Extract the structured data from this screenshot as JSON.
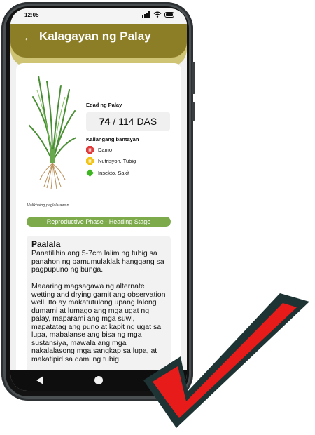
{
  "status_bar": {
    "time": "12:05"
  },
  "header": {
    "back_icon": "back-arrow-icon",
    "title": "Kalagayan ng Palay"
  },
  "plant": {
    "image_icon": "rice-plant-icon",
    "caption": "Malikhaing paglalarawan"
  },
  "age": {
    "label": "Edad ng Palay",
    "current": "74",
    "separator": "/",
    "total": "114 DAS"
  },
  "watch": {
    "label": "Kailangang bantayan",
    "items": [
      {
        "icon": "weed-warning-icon",
        "label": "Damo",
        "color": "#e03a3a"
      },
      {
        "icon": "nutrition-warning-icon",
        "label": "Nutrisyon, Tubig",
        "color": "#f2c416"
      },
      {
        "icon": "pest-warning-icon",
        "label": "Insekto, Sakit",
        "color": "#3cb521"
      }
    ]
  },
  "phase": {
    "label": "Reproductive Phase - Heading Stage",
    "color": "#7dab4c"
  },
  "note": {
    "title": "Paalala",
    "paragraph1": "Panatilihin ang 5-7cm lalim ng tubig sa panahon ng pamumulaklak hanggang sa pagpupuno ng bunga.",
    "paragraph2": "Maaaring magsagawa ng alternate wetting and drying gamit ang observation well. Ito ay makatutulong upang lalong dumami at lumago ang mga ugat ng palay, maparami ang mga suwi, mapatatag ang puno at kapit ng ugat sa lupa, mabalanse ang bisa ng mga sustansiya, mawala ang mga nakalalasong mga sangkap sa lupa, at makatipid sa dami ng tubig"
  },
  "navbar": {
    "back": "nav-back-icon",
    "home": "nav-home-icon",
    "recents": "nav-recents-icon"
  },
  "colors": {
    "header": "#8c7d27",
    "header_edge": "#cfc374",
    "checkmark": "#e81b1b",
    "checkmark_outline": "#1e3434"
  }
}
